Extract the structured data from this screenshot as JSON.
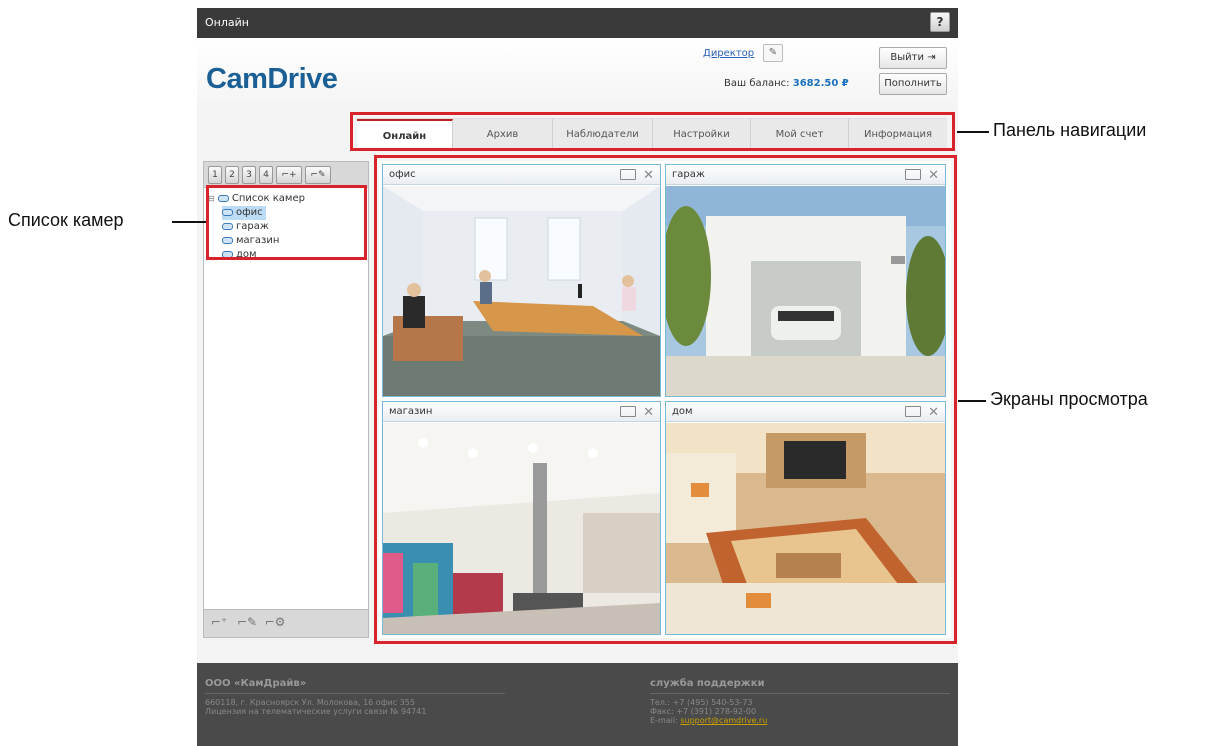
{
  "topbar": {
    "title": "Онлайн",
    "help_label": "?"
  },
  "header": {
    "logo": "CamDrive",
    "user_link": "Директор",
    "balance_label": "Ваш баланс:",
    "balance_value": "3682.50 ₽",
    "logout_label": "Выйти",
    "topup_label": "Пополнить"
  },
  "nav": {
    "tabs": [
      {
        "label": "Онлайн"
      },
      {
        "label": "Архив"
      },
      {
        "label": "Наблюдатели"
      },
      {
        "label": "Настройки"
      },
      {
        "label": "Мой счет"
      },
      {
        "label": "Информация"
      }
    ]
  },
  "left": {
    "layout_buttons": [
      "1",
      "2",
      "3",
      "4"
    ],
    "tree_root": "Список камер",
    "cameras": [
      "офис",
      "гараж",
      "магазин",
      "дом"
    ],
    "selected_camera": "офис"
  },
  "views": [
    {
      "title": "офис"
    },
    {
      "title": "гараж"
    },
    {
      "title": "магазин"
    },
    {
      "title": "дом"
    }
  ],
  "footer": {
    "company": "ООО «КамДрайв»",
    "address": "660118, г. Красноярск Ул. Молокова, 16 офис 355",
    "license": "Лицензия на телематические услуги связи № 94741",
    "support_title": "служба поддержки",
    "phone": "Тел.: +7 (495) 540-53-73",
    "fax": "Факс: +7 (391) 278-92-00",
    "email_label": "E-mail:",
    "email": "support@camdrive.ru"
  },
  "annotations": {
    "nav_panel": "Панель навигации",
    "camera_list": "Список камер",
    "view_screens": "Экраны просмотра"
  },
  "colors": {
    "accent": "#1a5f95",
    "annotation": "#d8232a"
  }
}
